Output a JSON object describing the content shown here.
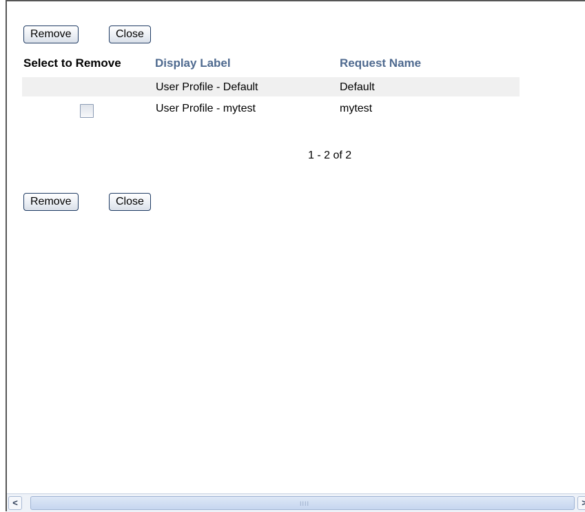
{
  "toolbar_top": {
    "remove_label": "Remove",
    "close_label": "Close"
  },
  "toolbar_bottom": {
    "remove_label": "Remove",
    "close_label": "Close"
  },
  "table": {
    "columns": [
      "Select to Remove",
      "Display Label",
      "Request Name"
    ],
    "rows": [
      {
        "display_label": "User Profile - Default",
        "request_name": "Default",
        "selectable": false
      },
      {
        "display_label": "User Profile - mytest",
        "request_name": "mytest",
        "selectable": true,
        "checked": false
      }
    ]
  },
  "pagination": {
    "text": "1 - 2 of 2"
  },
  "scrollbar": {
    "left_arrow": "<",
    "right_arrow": ">",
    "grip": "IIII"
  },
  "colors": {
    "header_link": "#4f6a8f",
    "button_border": "#1f3b63",
    "row_shade": "#f0f0f0"
  }
}
